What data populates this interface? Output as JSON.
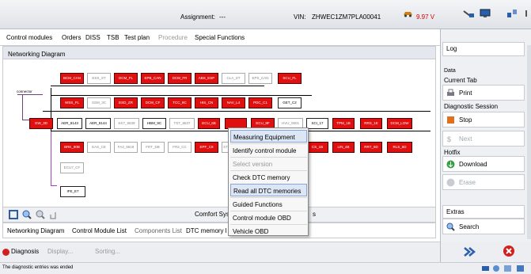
{
  "header": {
    "assignment_label": "Assignment:",
    "assignment_value": "---",
    "vin_label": "VIN:",
    "vin_value": "ZHWEC1ZM7PLA00041",
    "voltage": "9.97 V"
  },
  "tabs": [
    "Control modules",
    "Orders",
    "DISS",
    "TSB",
    "Test plan",
    "Procedure",
    "Special Functions"
  ],
  "networking_title": "Networking Diagram",
  "connector_label": "connector",
  "modules": [
    {
      "label": "BCM_CAN",
      "state": "red"
    },
    {
      "label": "ESS_ST",
      "state": "grey"
    },
    {
      "label": "DCM_FL",
      "state": "red"
    },
    {
      "label": "EPB_CAN",
      "state": "red"
    },
    {
      "label": "DCM_FR",
      "state": "red"
    },
    {
      "label": "ABS_ESP",
      "state": "red"
    },
    {
      "label": "CLA_ST",
      "state": "grey"
    },
    {
      "label": "EPS_CAN",
      "state": "grey"
    },
    {
      "label": "SCU_FL",
      "state": "red"
    },
    {
      "label": "WSS_FL",
      "state": "red"
    },
    {
      "label": "SSM_3C",
      "state": "grey"
    },
    {
      "label": "ESD_ZR",
      "state": "red"
    },
    {
      "label": "DCM_CF",
      "state": "red"
    },
    {
      "label": "TCC_8C",
      "state": "red"
    },
    {
      "label": "HIS_CN",
      "state": "red"
    },
    {
      "label": "NAV_L4",
      "state": "red"
    },
    {
      "label": "PDC_C1",
      "state": "red"
    },
    {
      "label": "GET_C2",
      "state": "white"
    },
    {
      "label": "GW_3D",
      "state": "red"
    },
    {
      "label": "AER_8143",
      "state": "white"
    },
    {
      "label": "AER_8144",
      "state": "white"
    },
    {
      "label": "KK7_8639",
      "state": "grey"
    },
    {
      "label": "HBM_9C",
      "state": "white"
    },
    {
      "label": "TST_8637",
      "state": "grey"
    },
    {
      "label": "ECU_6B",
      "state": "red"
    },
    {
      "label": "",
      "state": "red"
    },
    {
      "label": "ECU_8F",
      "state": "red"
    },
    {
      "label": "HVU_0601",
      "state": "grey"
    },
    {
      "label": "SCI_17",
      "state": "white"
    },
    {
      "label": "TPM_1B",
      "state": "red"
    },
    {
      "label": "RRS_1E",
      "state": "red"
    },
    {
      "label": "DCM_LOW",
      "state": "red"
    },
    {
      "label": "BRK_80B",
      "state": "red"
    },
    {
      "label": "EAS_CE",
      "state": "grey"
    },
    {
      "label": "FA3_9618",
      "state": "grey"
    },
    {
      "label": "FRT_DB",
      "state": "grey"
    },
    {
      "label": "FR2_CC",
      "state": "grey"
    },
    {
      "label": "EPF_C8",
      "state": "red"
    },
    {
      "label": "ST",
      "state": "grey"
    },
    {
      "label": "CS_1B",
      "state": "red"
    },
    {
      "label": "LIN_4B",
      "state": "red"
    },
    {
      "label": "RRT_6D",
      "state": "red"
    },
    {
      "label": "RLS_6D",
      "state": "red"
    },
    {
      "label": "ECU7_CF",
      "state": "grey"
    },
    {
      "label": "IFE_E7",
      "state": "white"
    }
  ],
  "comfort_label": "Comfort Sys",
  "comfort_suffix": "s",
  "bottom_tabs": [
    "Networking Diagram",
    "Control Module List",
    "Components List",
    "DTC memory l"
  ],
  "context_menu": [
    {
      "label": "Measuring Equipment",
      "state": "highlight"
    },
    {
      "label": "Identify control module",
      "state": "normal"
    },
    {
      "label": "Select version",
      "state": "disabled"
    },
    {
      "label": "Check DTC memory",
      "state": "normal"
    },
    {
      "label": "Read all DTC memories",
      "state": "highlight"
    },
    {
      "label": "Guided Functions",
      "state": "normal"
    },
    {
      "label": "Control module OBD",
      "state": "normal"
    },
    {
      "label": "Vehicle OBD",
      "state": "normal"
    }
  ],
  "actions": {
    "diagnosis": "Diagnosis",
    "display": "Display...",
    "sorting": "Sorting..."
  },
  "status_text": "The diagnostic entries was ended",
  "right_panel": {
    "log": "Log",
    "data": "Data",
    "current_tab": "Current Tab",
    "print": "Print",
    "diag_session": "Diagnostic Session",
    "stop": "Stop",
    "next": "Next",
    "hotfix": "Hotfix",
    "download": "Download",
    "erase": "Erase",
    "extras": "Extras",
    "search": "Search"
  },
  "colors": {
    "module_red": "#e01010",
    "accent_blue": "#2c5fb0",
    "panel_bg": "#eef0f4"
  }
}
